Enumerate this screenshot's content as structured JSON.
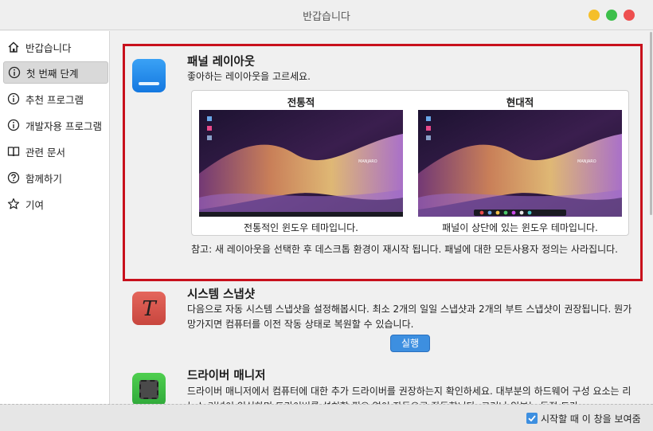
{
  "window": {
    "title": "반갑습니다"
  },
  "sidebar": {
    "items": [
      {
        "label": "반갑습니다",
        "icon": "home-icon"
      },
      {
        "label": "첫 번째 단계",
        "icon": "info-icon",
        "active": true
      },
      {
        "label": "추천 프로그램",
        "icon": "info-icon"
      },
      {
        "label": "개발자용 프로그램",
        "icon": "info-icon"
      },
      {
        "label": "관련 문서",
        "icon": "book-icon"
      },
      {
        "label": "함께하기",
        "icon": "help-icon"
      },
      {
        "label": "기여",
        "icon": "star-icon"
      }
    ]
  },
  "sections": {
    "panel": {
      "title": "패널 레이아웃",
      "desc": "좋아하는 레이아웃을 고르세요.",
      "traditional": {
        "title": "전통적",
        "desc": "전통적인 윈도우 테마입니다."
      },
      "modern": {
        "title": "현대적",
        "desc": "패널이 상단에 있는 윈도우 테마입니다."
      },
      "note": "참고: 새 레이아웃을 선택한 후 데스크톱 환경이 재시작 됩니다. 패널에 대한 모든사용자 정의는 사라집니다."
    },
    "snapshot": {
      "title": "시스템 스냅샷",
      "desc": "다음으로 자동 시스템 스냅샷을 설정해봅시다. 최소 2개의 일일 스냅샷과 2개의 부트 스냅샷이 권장됩니다. 뭔가 망가지면 컴퓨터를 이전 작동 상태로 복원할 수 있습니다.",
      "run_label": "실행"
    },
    "driver": {
      "title": "드라이버 매니저",
      "desc": "드라이버 매니저에서 컴퓨터에 대한 추가 드라이버를 권장하는지 확인하세요. 대부분의 하드웨어 구성 요소는 리눅스 커널이 인식하며 드라이버를 설치할 필요 없이 자동으로 작동합니다. 그러나 일부는 독점 드라"
    }
  },
  "footer": {
    "checkbox_label": "시작할 때 이 창을 보여줌",
    "checked": true
  },
  "colors": {
    "accent": "#3d8fe0",
    "highlight": "#c8101c"
  }
}
